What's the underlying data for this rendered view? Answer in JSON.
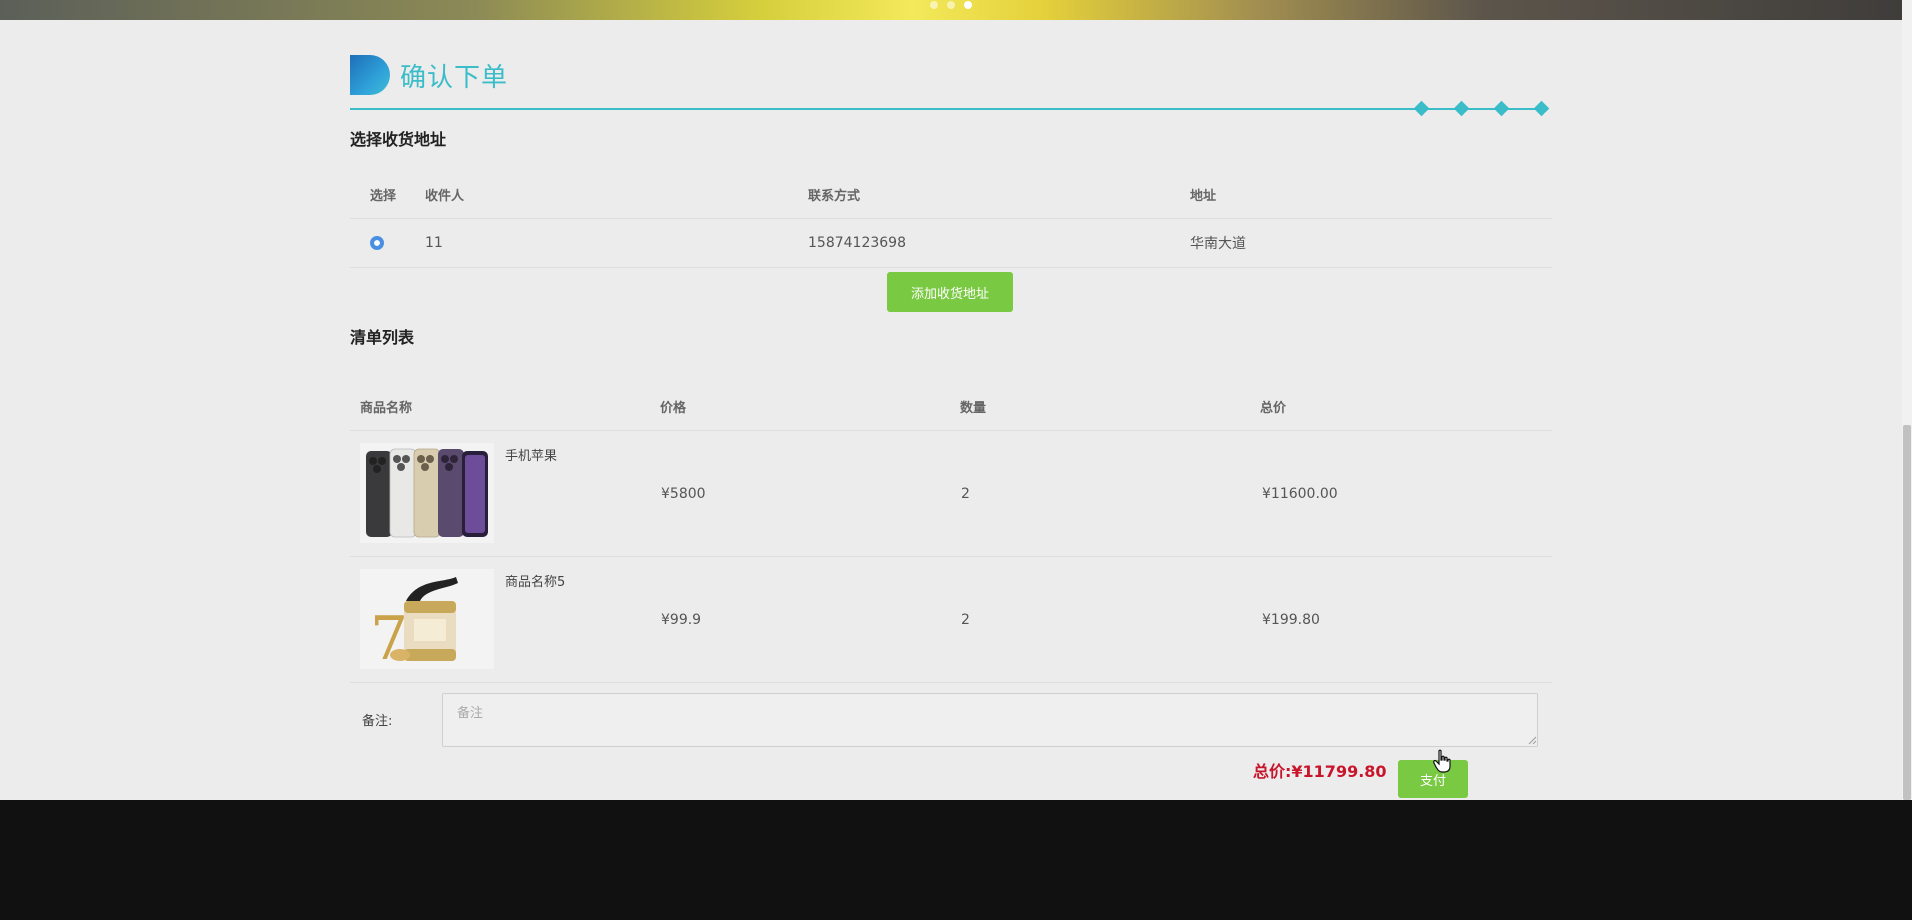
{
  "banner": {
    "slides": 3,
    "active_slide": 3
  },
  "page": {
    "title": "确认下单"
  },
  "address_section": {
    "title": "选择收货地址",
    "columns": [
      "选择",
      "收件人",
      "联系方式",
      "地址"
    ],
    "rows": [
      {
        "selected": true,
        "recipient": "11",
        "phone": "15874123698",
        "address": "华南大道"
      }
    ],
    "add_button": "添加收货地址"
  },
  "items_section": {
    "title": "清单列表",
    "columns": [
      "商品名称",
      "价格",
      "数量",
      "总价"
    ],
    "rows": [
      {
        "name": "手机苹果",
        "price": "¥5800",
        "quantity": "2",
        "subtotal": "¥11600.00",
        "image": "iphone-product-icon"
      },
      {
        "name": "商品名称5",
        "price": "¥99.9",
        "quantity": "2",
        "subtotal": "¥199.80",
        "image": "cream-jar-product-icon"
      }
    ]
  },
  "remark": {
    "label": "备注:",
    "placeholder": "备注",
    "value": ""
  },
  "summary": {
    "total_label": "总价:",
    "total_value": "¥11799.80",
    "pay_button": "支付"
  },
  "colors": {
    "accent": "#3bbcc9",
    "button_green": "#7ac943",
    "total_red": "#c9152b",
    "radio_blue": "#4a90e2"
  }
}
